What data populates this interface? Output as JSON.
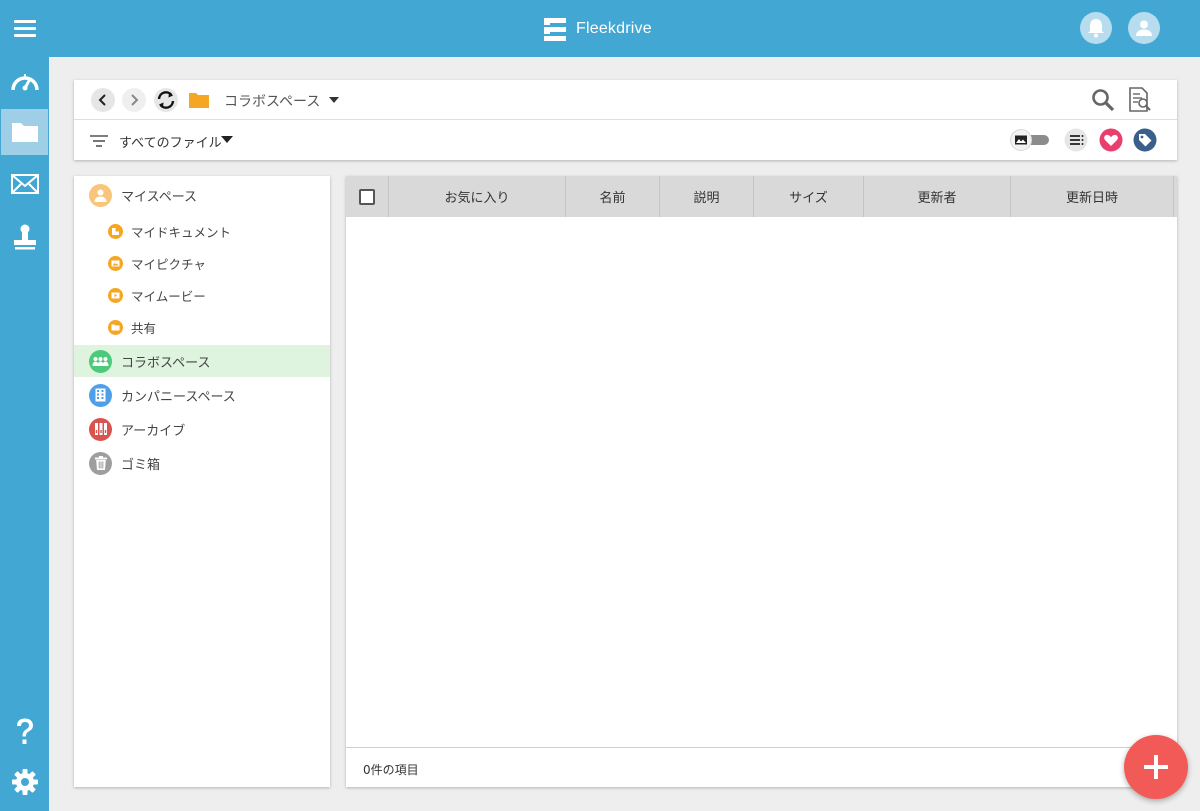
{
  "app": {
    "name": "Fleekdrive",
    "brand_color": "#42a7d2",
    "accent_fab": "#f15a57"
  },
  "topbar": {
    "menu_icon": "hamburger-menu-icon",
    "notification_icon": "bell-icon",
    "account_icon": "user-icon"
  },
  "rail": {
    "items": [
      {
        "icon": "dashboard-gauge-icon"
      },
      {
        "icon": "folder-icon",
        "active": true
      },
      {
        "icon": "mail-icon"
      },
      {
        "icon": "stamp-icon"
      }
    ],
    "bottom": [
      {
        "icon": "help-question-icon"
      },
      {
        "icon": "settings-gear-icon"
      }
    ]
  },
  "toolbar": {
    "breadcrumb": "コラボスペース",
    "filter_label": "すべてのファイル",
    "view_toggle": "image-view-toggle",
    "icons": [
      "search-icon",
      "document-search-icon",
      "list-view-icon",
      "favorite-heart-icon",
      "tag-icon"
    ]
  },
  "tree": {
    "my_space": "マイスペース",
    "sub_items": [
      "マイドキュメント",
      "マイピクチャ",
      "マイムービー",
      "共有"
    ],
    "collab_space": "コラボスペース",
    "company_space": "カンパニースペース",
    "archive": "アーカイブ",
    "trash": "ゴミ箱"
  },
  "list": {
    "columns": [
      "お気に入り",
      "名前",
      "説明",
      "サイズ",
      "更新者",
      "更新日時"
    ],
    "rows": [],
    "count_text": "0件の項目"
  }
}
